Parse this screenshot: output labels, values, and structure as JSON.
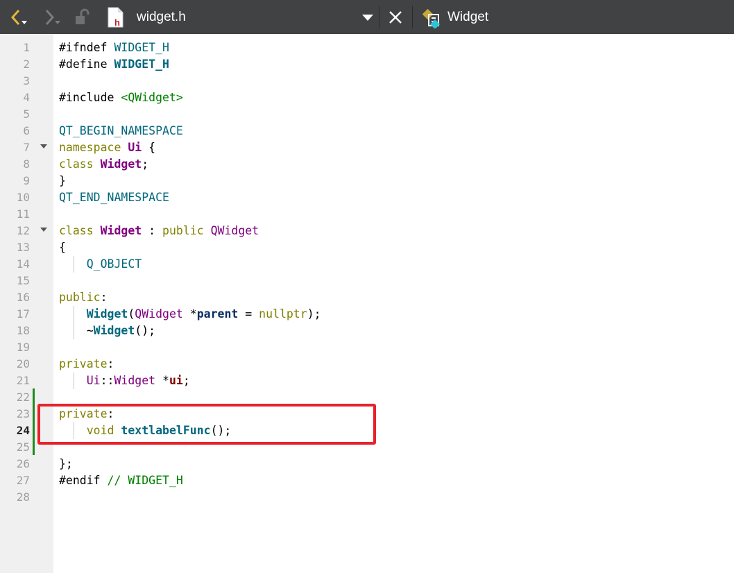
{
  "toolbar": {
    "file_name": "widget.h",
    "class_name": "Widget",
    "icons": [
      "back-arrow-icon",
      "forward-arrow-icon",
      "lock-icon",
      "header-file-icon",
      "dropdown-icon",
      "close-icon",
      "class-icon"
    ]
  },
  "editor": {
    "current_line": 24,
    "line_numbers": [
      "1",
      "2",
      "3",
      "4",
      "5",
      "6",
      "7",
      "8",
      "9",
      "10",
      "11",
      "12",
      "13",
      "14",
      "15",
      "16",
      "17",
      "18",
      "19",
      "20",
      "21",
      "22",
      "23",
      "24",
      "25",
      "26",
      "27",
      "28"
    ],
    "lines": [
      [
        {
          "t": "#ifndef ",
          "c": ""
        },
        {
          "t": "WIDGET_H",
          "c": "m"
        }
      ],
      [
        {
          "t": "#define ",
          "c": ""
        },
        {
          "t": "WIDGET_H",
          "c": "mb"
        }
      ],
      [],
      [
        {
          "t": "#include ",
          "c": ""
        },
        {
          "t": "<QWidget>",
          "c": "s"
        }
      ],
      [],
      [
        {
          "t": "QT_BEGIN_NAMESPACE",
          "c": "m"
        }
      ],
      [
        {
          "t": "namespace ",
          "c": "k"
        },
        {
          "t": "Ui",
          "c": "tb2"
        },
        {
          "t": " {",
          "c": ""
        }
      ],
      [
        {
          "t": "class ",
          "c": "k"
        },
        {
          "t": "Widget",
          "c": "tb2"
        },
        {
          "t": ";",
          "c": ""
        }
      ],
      [
        {
          "t": "}",
          "c": ""
        }
      ],
      [
        {
          "t": "QT_END_NAMESPACE",
          "c": "m"
        }
      ],
      [],
      [
        {
          "t": "class ",
          "c": "k"
        },
        {
          "t": "Widget",
          "c": "tb2"
        },
        {
          "t": " : ",
          "c": ""
        },
        {
          "t": "public ",
          "c": "k"
        },
        {
          "t": "QWidget",
          "c": "t"
        }
      ],
      [
        {
          "t": "{",
          "c": ""
        }
      ],
      [
        {
          "t": "    ",
          "c": ""
        },
        {
          "t": "Q_OBJECT",
          "c": "m"
        }
      ],
      [],
      [
        {
          "t": "public",
          "c": "k"
        },
        {
          "t": ":",
          "c": ""
        }
      ],
      [
        {
          "t": "    ",
          "c": ""
        },
        {
          "t": "Widget",
          "c": "f"
        },
        {
          "t": "(",
          "c": ""
        },
        {
          "t": "QWidget",
          "c": "t"
        },
        {
          "t": " *",
          "c": ""
        },
        {
          "t": "parent",
          "c": "v"
        },
        {
          "t": " = ",
          "c": ""
        },
        {
          "t": "nullptr",
          "c": "k"
        },
        {
          "t": ");",
          "c": ""
        }
      ],
      [
        {
          "t": "    ~",
          "c": ""
        },
        {
          "t": "Widget",
          "c": "f"
        },
        {
          "t": "();",
          "c": ""
        }
      ],
      [],
      [
        {
          "t": "private",
          "c": "k"
        },
        {
          "t": ":",
          "c": ""
        }
      ],
      [
        {
          "t": "    ",
          "c": ""
        },
        {
          "t": "Ui",
          "c": "t"
        },
        {
          "t": "::",
          "c": ""
        },
        {
          "t": "Widget",
          "c": "t"
        },
        {
          "t": " *",
          "c": ""
        },
        {
          "t": "ui",
          "c": "mem"
        },
        {
          "t": ";",
          "c": ""
        }
      ],
      [],
      [
        {
          "t": "private",
          "c": "k"
        },
        {
          "t": ":",
          "c": ""
        }
      ],
      [
        {
          "t": "    ",
          "c": ""
        },
        {
          "t": "void ",
          "c": "k"
        },
        {
          "t": "textlabelFunc",
          "c": "f"
        },
        {
          "t": "();",
          "c": ""
        }
      ],
      [],
      [
        {
          "t": "};",
          "c": ""
        }
      ],
      [
        {
          "t": "#endif ",
          "c": ""
        },
        {
          "t": "// WIDGET_H",
          "c": "c"
        }
      ],
      []
    ]
  }
}
